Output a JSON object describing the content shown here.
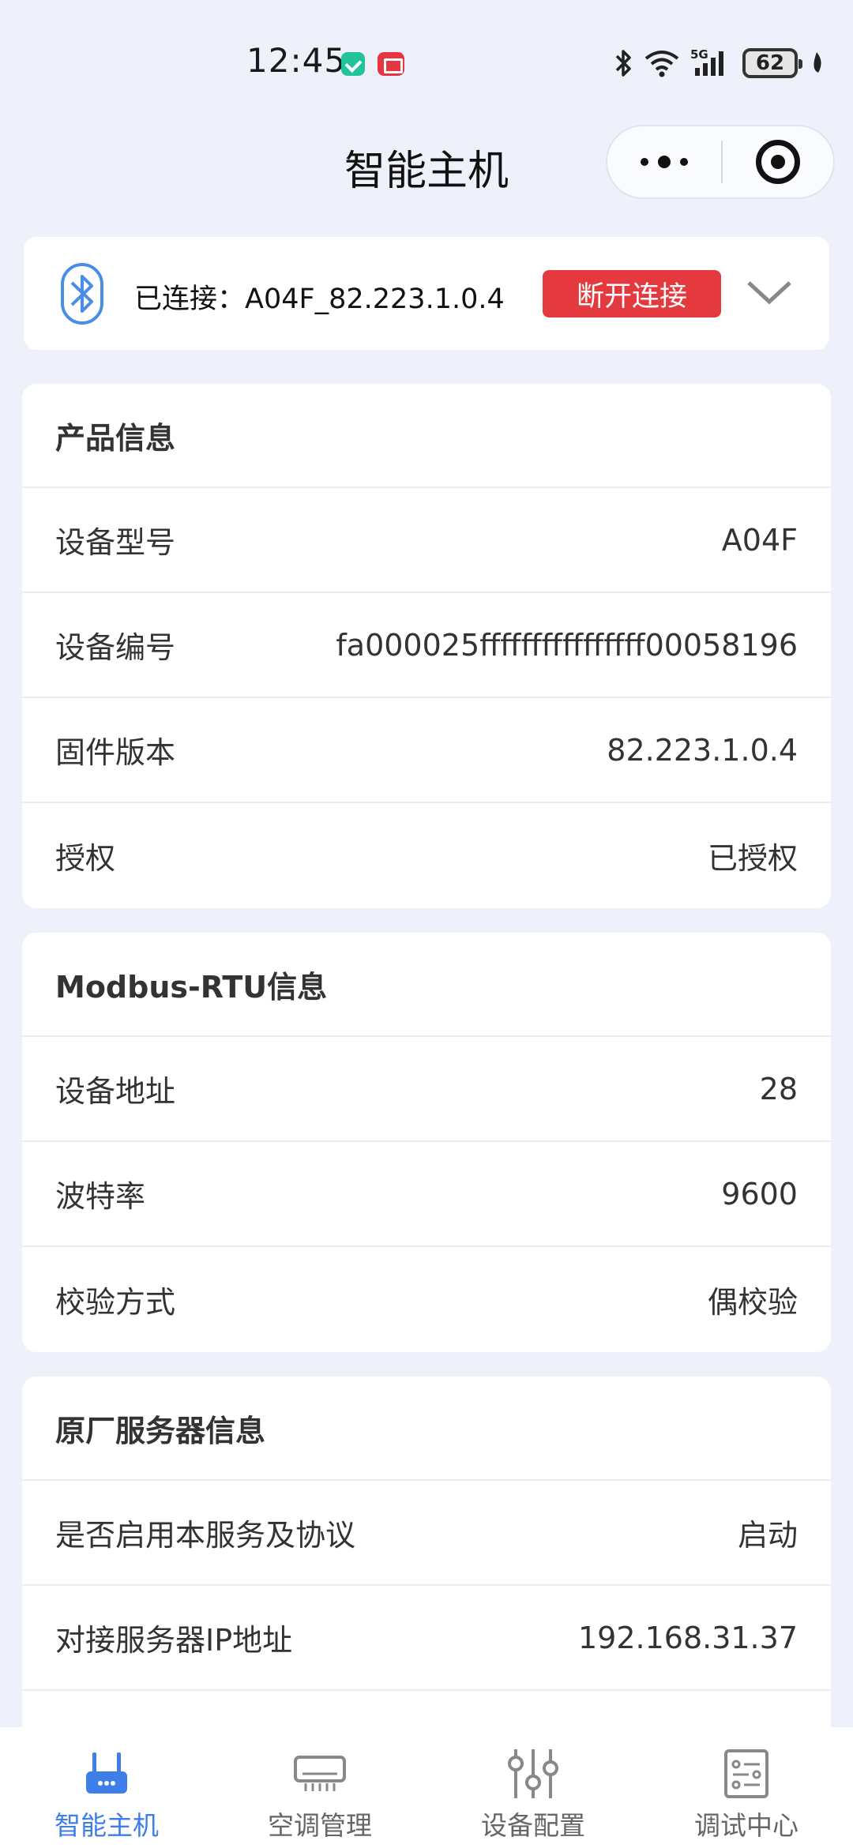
{
  "status_bar": {
    "time": "12:45",
    "battery": "62"
  },
  "header": {
    "title": "智能主机"
  },
  "connection": {
    "status_text": "已连接：A04F_82.223.1.0.4",
    "disconnect_label": "断开连接"
  },
  "product_info": {
    "title": "产品信息",
    "rows": [
      {
        "label": "设备型号",
        "value": "A04F"
      },
      {
        "label": "设备编号",
        "value": "fa000025ffffffffffffffff00058196"
      },
      {
        "label": "固件版本",
        "value": "82.223.1.0.4"
      },
      {
        "label": "授权",
        "value": "已授权"
      }
    ]
  },
  "modbus_info": {
    "title": "Modbus-RTU信息",
    "rows": [
      {
        "label": "设备地址",
        "value": "28"
      },
      {
        "label": "波特率",
        "value": "9600"
      },
      {
        "label": "校验方式",
        "value": "偶校验"
      }
    ]
  },
  "server_info": {
    "title": "原厂服务器信息",
    "rows": [
      {
        "label": "是否启用本服务及协议",
        "value": "启动"
      },
      {
        "label": "对接服务器IP地址",
        "value": "192.168.31.37"
      }
    ]
  },
  "tab_bar": {
    "tabs": [
      {
        "label": "智能主机",
        "icon": "router-icon",
        "active": true
      },
      {
        "label": "空调管理",
        "icon": "air-conditioner-icon",
        "active": false
      },
      {
        "label": "设备配置",
        "icon": "sliders-icon",
        "active": false
      },
      {
        "label": "调试中心",
        "icon": "checklist-icon",
        "active": false
      }
    ]
  },
  "colors": {
    "background": "#eef1fa",
    "accent": "#3d7ee8",
    "danger": "#e4393f"
  }
}
